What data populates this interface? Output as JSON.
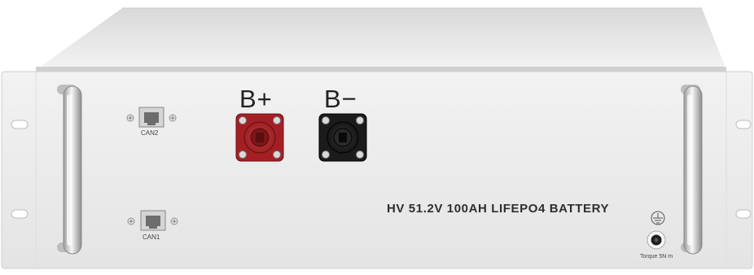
{
  "device": {
    "model_text": "HV 51.2V 100AH LIFEPO4 BATTERY",
    "positive_terminal": "B+",
    "negative_terminal": "B−",
    "port_top": "CAN2",
    "port_bottom": "CAN1",
    "torque_text": "Torque 5N m",
    "colors": {
      "panel": "#ebebeb",
      "positive": "#b3262a",
      "negative": "#1c1c1c"
    },
    "icons": [
      "ground-icon",
      "rj45-port-icon",
      "handle-icon",
      "screw-icon"
    ]
  }
}
